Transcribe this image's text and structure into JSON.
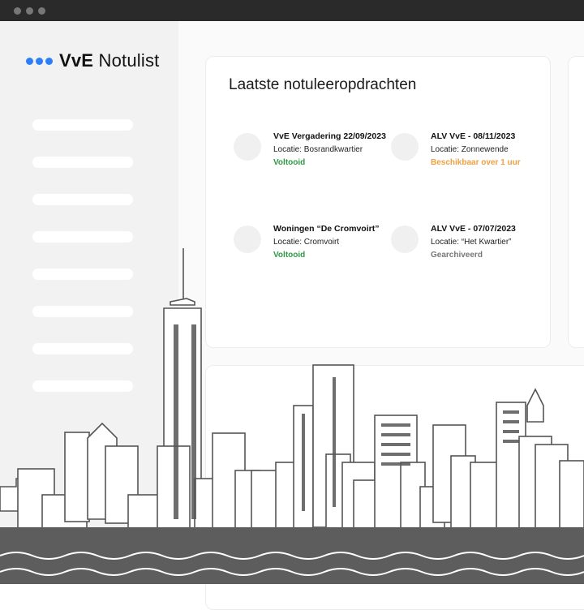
{
  "app": {
    "name_bold": "VvE",
    "name_rest": "Notulist"
  },
  "sidebar": {
    "nav_item_count_visual": 8
  },
  "card": {
    "title": "Laatste notuleeropdrachten",
    "tasks": [
      {
        "title": "VvE Vergadering 22/09/2023",
        "location": "Locatie: Bosrandkwartier",
        "status": "Voltooid",
        "status_color": "#2e9a44"
      },
      {
        "title": "ALV VvE - 08/11/2023",
        "location": "Locatie: Zonnewende",
        "status": "Beschikbaar over 1 uur",
        "status_color": "#f0a040"
      },
      {
        "title": "Woningen “De Cromvoirt”",
        "location": "Locatie: Cromvoirt",
        "status": "Voltooid",
        "status_color": "#2e9a44"
      },
      {
        "title": "ALV VvE - 07/07/2023",
        "location": "Locatie: “Het Kwartier”",
        "status": "Gearchiveerd",
        "status_color": "#777777"
      }
    ]
  },
  "colors": {
    "accent": "#2d7ff9",
    "titlebar": "#2a2a2a",
    "sidebar_bg": "#f2f2f2"
  }
}
